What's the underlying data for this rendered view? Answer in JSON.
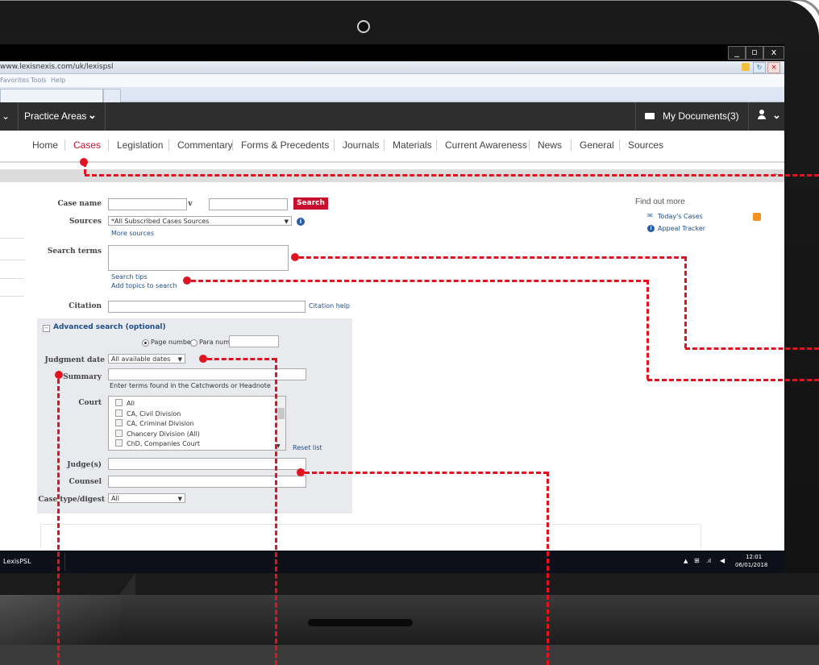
{
  "browser": {
    "url": "www.lexisnexis.com/uk/lexispsl",
    "menu": [
      "Favorites",
      "Tools",
      "Help"
    ],
    "window_controls": [
      "_",
      "▫",
      "x"
    ]
  },
  "app_nav": {
    "practice_areas": "Practice Areas",
    "my_documents": "My Documents",
    "doc_count": "(3)"
  },
  "section_nav": {
    "items": [
      "Home",
      "Cases",
      "Legislation",
      "Commentary",
      "Forms & Precedents",
      "Journals",
      "Materials",
      "Current Awareness",
      "News",
      "General",
      "Sources"
    ],
    "active": "Cases"
  },
  "form": {
    "case_name_label": "Case name",
    "versus": "v",
    "search_button": "Search",
    "sources_label": "Sources",
    "sources_value": "*All Subscribed Cases Sources",
    "more_sources": "More sources",
    "search_terms_label": "Search terms",
    "search_tips": "Search tips",
    "add_topics": "Add topics to search",
    "citation_label": "Citation",
    "citation_help": "Citation help",
    "advanced_search": "Advanced search (optional)",
    "page_number": "Page number",
    "para_number": "Para number",
    "judgment_date_label": "Judgment date",
    "judgment_date_value": "All available dates",
    "summary_label": "Summary",
    "summary_hint": "Enter terms found in the Catchwords or Headnote",
    "court_label": "Court",
    "courts": [
      "All",
      "CA, Civil Division",
      "CA, Criminal Division",
      "Chancery Division (All)",
      "ChD, Companies Court"
    ],
    "reset_list": "Reset list",
    "judges_label": "Judge(s)",
    "counsel_label": "Counsel",
    "case_type_label": "Case type/digest",
    "case_type_value": "All"
  },
  "find_out_more": {
    "title": "Find out more",
    "links": [
      "Today's Cases",
      "Appeal Tracker"
    ]
  },
  "taskbar": {
    "app": "LexisPSL",
    "time": "12:01",
    "date": "06/01/2018"
  },
  "colors": {
    "accent": "#c8102e",
    "annotation": "#e01421",
    "link": "#1f4f8a",
    "nav_dark": "#2e2e2e"
  }
}
